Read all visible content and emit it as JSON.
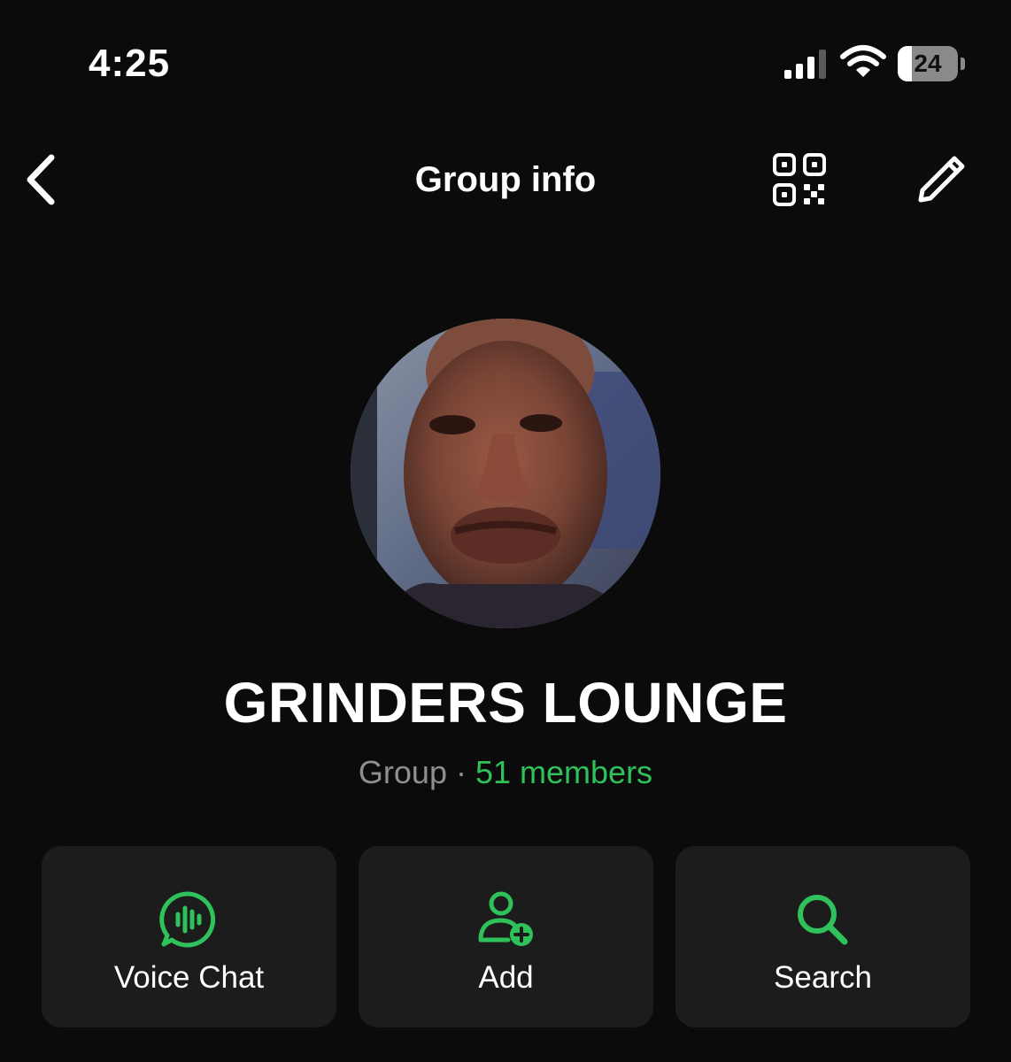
{
  "status_bar": {
    "time": "4:25",
    "battery_level": "24",
    "battery_fraction": 0.24,
    "signal_icon": "cellular-signal-icon",
    "wifi_icon": "wifi-icon"
  },
  "nav": {
    "title": "Group info",
    "back_icon": "chevron-left-icon",
    "qr_icon": "qr-code-icon",
    "edit_icon": "pencil-icon"
  },
  "group": {
    "name": "GRINDERS LOUNGE",
    "type": "Group",
    "separator": "·",
    "members": "51 members"
  },
  "actions": [
    {
      "label": "Voice Chat",
      "icon": "voice-chat-icon"
    },
    {
      "label": "Add",
      "icon": "add-person-icon"
    },
    {
      "label": "Search",
      "icon": "search-icon"
    }
  ],
  "colors": {
    "background": "#0b0b0b",
    "card": "#1c1c1c",
    "accent_green": "#2fc25b",
    "secondary_text": "#8e8e93"
  }
}
